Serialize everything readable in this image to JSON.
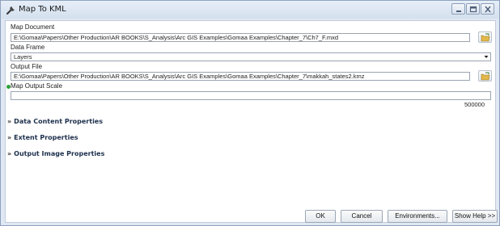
{
  "window": {
    "title": "Map To KML",
    "title_icon": "tool-wrench-icon"
  },
  "form": {
    "map_document": {
      "label": "Map Document",
      "value": "E:\\Gomaa\\Papers\\Other Production\\AR BOOKS\\S_Analysis\\Arc GIS Examples\\Gomaa Examples\\Chapter_7\\Ch7_F.mxd"
    },
    "data_frame": {
      "label": "Data Frame",
      "value": "Layers"
    },
    "output_file": {
      "label": "Output File",
      "value": "E:\\Gomaa\\Papers\\Other Production\\AR BOOKS\\S_Analysis\\Arc GIS Examples\\Gomaa Examples\\Chapter_7\\makkah_states2.kmz"
    },
    "map_output_scale": {
      "label": "Map Output Scale",
      "value": "500000"
    }
  },
  "sections": [
    {
      "label": "Data Content Properties"
    },
    {
      "label": "Extent Properties"
    },
    {
      "label": "Output Image Properties"
    }
  ],
  "buttons": {
    "ok": "OK",
    "cancel": "Cancel",
    "environments": "Environments...",
    "show_help": "Show Help >>"
  }
}
